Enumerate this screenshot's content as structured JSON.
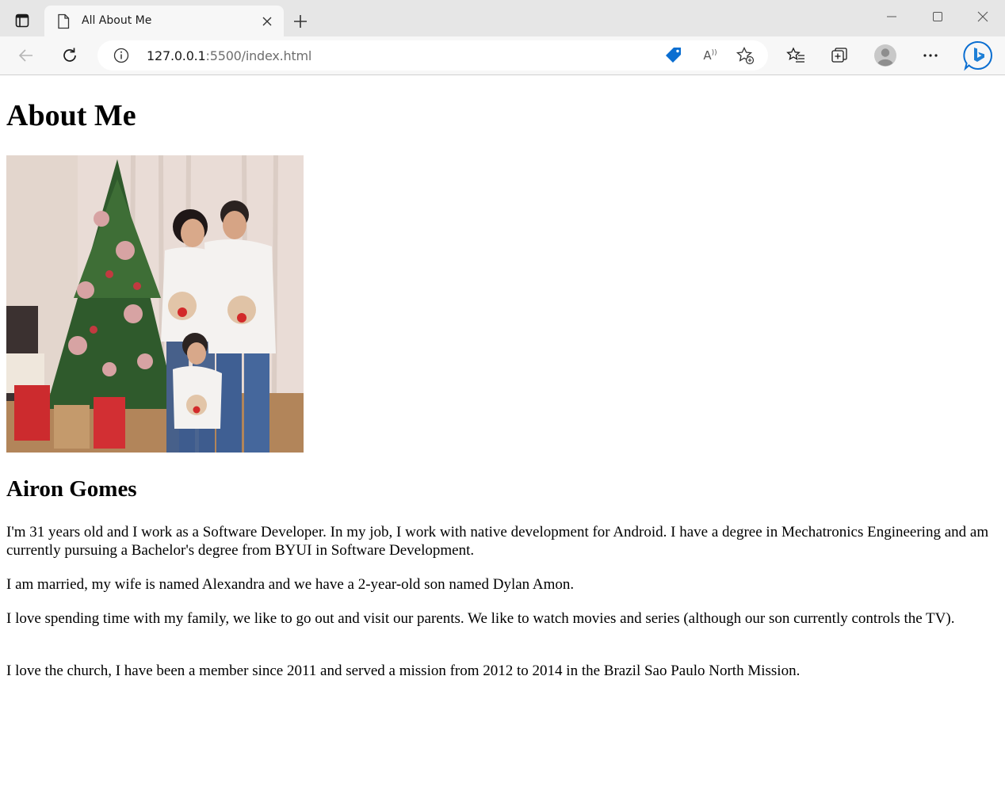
{
  "browser": {
    "tab_title": "All About Me",
    "url_host": "127.0.0.1",
    "url_rest": ":5500/index.html"
  },
  "page": {
    "heading": "About Me",
    "name": "Airon Gomes",
    "paragraphs": [
      "I'm 31 years old and I work as a Software Developer. In my job, I work with native development for Android. I have a degree in Mechatronics Engineering and am currently pursuing a Bachelor's degree from BYUI in Software Development.",
      "I am married, my wife is named Alexandra and we have a 2-year-old son named Dylan Amon.",
      "I love spending time with my family, we like to go out and visit our parents. We like to watch movies and series (although our son currently controls the TV).",
      "I love the church, I have been a member since 2011 and served a mission from 2012 to 2014 in the Brazil Sao Paulo North Mission."
    ]
  },
  "colors": {
    "tabbar_bg": "#e6e6e6",
    "toolbar_bg": "#f7f7f7",
    "accent_blue": "#0a6ed1"
  }
}
